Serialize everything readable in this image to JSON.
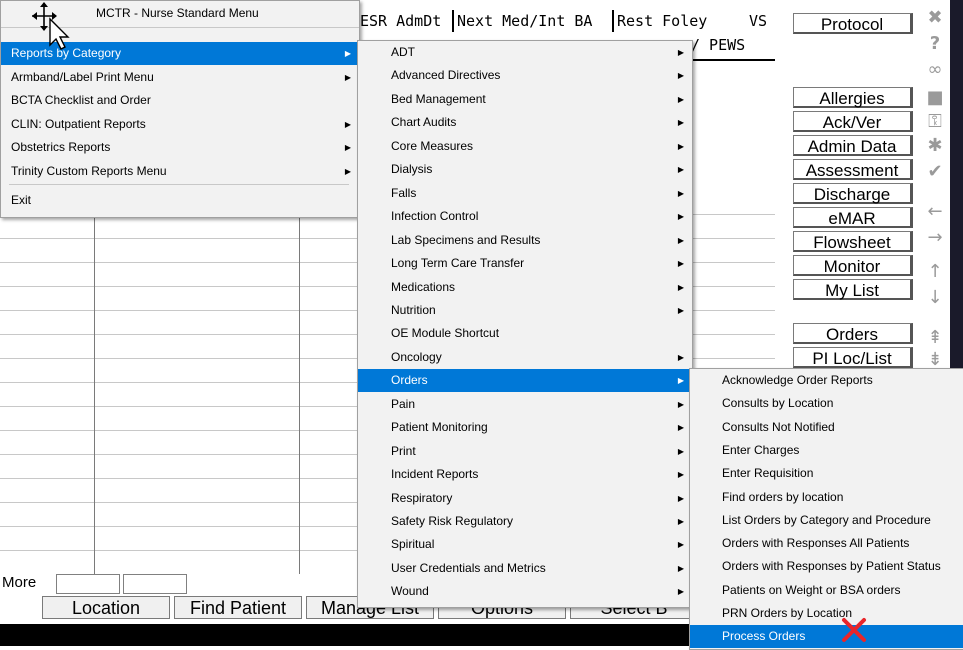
{
  "header_columns": {
    "row1": [
      "ESR AdmDt",
      "Next Med/Int BA",
      "Rest Foley",
      "VS"
    ],
    "row2": "/ PEWS"
  },
  "more": {
    "label": "More"
  },
  "bottom_buttons": [
    "Location",
    "Find Patient",
    "Manage List",
    "Options",
    "Select B"
  ],
  "side_buttons": [
    "Protocol",
    "Allergies",
    "Ack/Ver",
    "Admin Data",
    "Assessment",
    "Discharge",
    "eMAR",
    "Flowsheet",
    "Monitor",
    "My List",
    "Orders",
    "PI Loc/List"
  ],
  "toolbar_icons": [
    "close-icon",
    "help-icon",
    "binoculars-icon",
    "tag-icon",
    "keys-icon",
    "gear-icon",
    "check-all-icon",
    "arrow-left-icon",
    "arrow-right-icon",
    "arrow-up-icon",
    "arrow-down-icon",
    "scroll-up-icon",
    "scroll-down-icon"
  ],
  "menu1": {
    "title": "MCTR - Nurse Standard Menu",
    "items": [
      {
        "label": "Reports by Category",
        "submenu": true,
        "highlighted": true
      },
      {
        "label": "Armband/Label Print Menu",
        "submenu": true
      },
      {
        "label": "BCTA Checklist and Order",
        "submenu": false
      },
      {
        "label": "CLIN: Outpatient Reports",
        "submenu": true
      },
      {
        "label": "Obstetrics Reports",
        "submenu": true
      },
      {
        "label": "Trinity Custom Reports Menu",
        "submenu": true
      },
      {
        "label": "Exit",
        "submenu": false
      }
    ]
  },
  "menu2": {
    "items": [
      {
        "label": "ADT",
        "submenu": true
      },
      {
        "label": "Advanced Directives",
        "submenu": true
      },
      {
        "label": "Bed Management",
        "submenu": true
      },
      {
        "label": "Chart Audits",
        "submenu": true
      },
      {
        "label": "Core Measures",
        "submenu": true
      },
      {
        "label": "Dialysis",
        "submenu": true
      },
      {
        "label": "Falls",
        "submenu": true
      },
      {
        "label": "Infection Control",
        "submenu": true
      },
      {
        "label": "Lab Specimens and Results",
        "submenu": true
      },
      {
        "label": "Long Term Care Transfer",
        "submenu": true
      },
      {
        "label": "Medications",
        "submenu": true
      },
      {
        "label": "Nutrition",
        "submenu": true
      },
      {
        "label": "OE Module Shortcut",
        "submenu": false
      },
      {
        "label": "Oncology",
        "submenu": true
      },
      {
        "label": "Orders",
        "submenu": true,
        "highlighted": true
      },
      {
        "label": "Pain",
        "submenu": true
      },
      {
        "label": "Patient Monitoring",
        "submenu": true
      },
      {
        "label": "Print",
        "submenu": true
      },
      {
        "label": "Incident Reports",
        "submenu": true
      },
      {
        "label": "Respiratory",
        "submenu": true
      },
      {
        "label": "Safety Risk Regulatory",
        "submenu": true
      },
      {
        "label": "Spiritual",
        "submenu": true
      },
      {
        "label": "User Credentials and Metrics",
        "submenu": true
      },
      {
        "label": "Wound",
        "submenu": true
      }
    ]
  },
  "menu3": {
    "items": [
      {
        "label": "Acknowledge Order Reports"
      },
      {
        "label": "Consults by Location"
      },
      {
        "label": "Consults Not Notified"
      },
      {
        "label": "Enter Charges"
      },
      {
        "label": "Enter Requisition"
      },
      {
        "label": "Find orders by location"
      },
      {
        "label": "List Orders by Category and Procedure"
      },
      {
        "label": "Orders with Responses All Patients"
      },
      {
        "label": "Orders with Responses by Patient Status"
      },
      {
        "label": "Patients on Weight or BSA orders"
      },
      {
        "label": "PRN Orders by Location"
      },
      {
        "label": "Process Orders",
        "highlighted": true
      }
    ]
  },
  "colors": {
    "highlight": "#0078d7",
    "menu_bg": "#f2f2f2",
    "annotation_x": "#e8252a"
  }
}
